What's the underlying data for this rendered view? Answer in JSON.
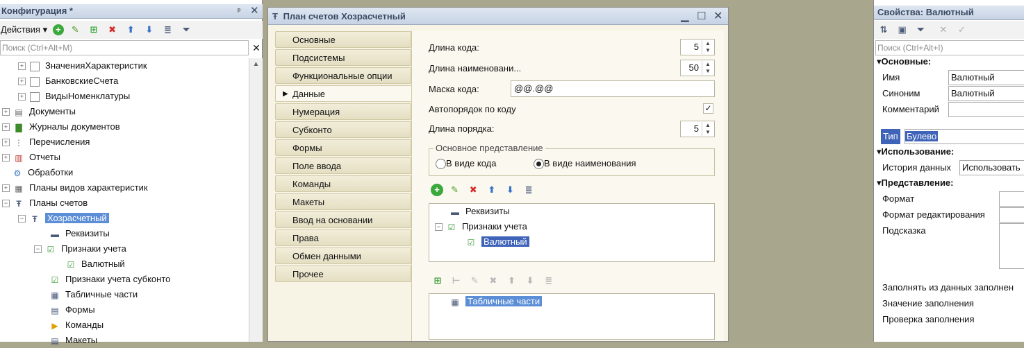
{
  "config_panel": {
    "title": "Конфигурация *",
    "pin": "ᵖ",
    "actions_label": "Действия",
    "search_placeholder": "Поиск (Ctrl+Alt+M)",
    "tree": [
      {
        "label": "ЗначенияХарактеристик"
      },
      {
        "label": "БанковскиеСчета"
      },
      {
        "label": "ВидыНоменклатуры"
      },
      {
        "label": "Документы"
      },
      {
        "label": "Журналы документов"
      },
      {
        "label": "Перечисления"
      },
      {
        "label": "Отчеты"
      },
      {
        "label": "Обработки"
      },
      {
        "label": "Планы видов характеристик"
      },
      {
        "label": "Планы счетов"
      },
      {
        "label": "Хозрасчетный"
      },
      {
        "label": "Реквизиты"
      },
      {
        "label": "Признаки учета"
      },
      {
        "label": "Валютный"
      },
      {
        "label": "Признаки учета субконто"
      },
      {
        "label": "Табличные части"
      },
      {
        "label": "Формы"
      },
      {
        "label": "Команды"
      },
      {
        "label": "Макеты"
      }
    ]
  },
  "window": {
    "title": "План счетов Хозрасчетный",
    "tabs": [
      {
        "label": "Основные"
      },
      {
        "label": "Подсистемы"
      },
      {
        "label": "Функциональные опции"
      },
      {
        "label": "Данные"
      },
      {
        "label": "Нумерация"
      },
      {
        "label": "Субконто"
      },
      {
        "label": "Формы"
      },
      {
        "label": "Поле ввода"
      },
      {
        "label": "Команды"
      },
      {
        "label": "Макеты"
      },
      {
        "label": "Ввод на основании"
      },
      {
        "label": "Права"
      },
      {
        "label": "Обмен данными"
      },
      {
        "label": "Прочее"
      }
    ],
    "active_tab": "Данные",
    "fields": {
      "code_length_label": "Длина кода:",
      "code_length_value": "5",
      "name_length_label": "Длина наименовани...",
      "name_length_value": "50",
      "code_mask_label": "Маска кода:",
      "code_mask_value": "@@.@@",
      "autoorder_label": "Автопорядок по коду",
      "autoorder_checked": true,
      "order_length_label": "Длина порядка:",
      "order_length_value": "5"
    },
    "main_repr": {
      "group_label": "Основное представление",
      "option_code": "В виде кода",
      "option_name": "В виде наименования",
      "selected": "В виде наименования"
    },
    "attrs_tree": [
      {
        "label": "Реквизиты"
      },
      {
        "label": "Признаки учета"
      },
      {
        "label": "Валютный"
      }
    ],
    "tabular_tree": [
      {
        "label": "Табличные части"
      }
    ]
  },
  "properties": {
    "title": "Свойства: Валютный",
    "search_placeholder": "Поиск (Ctrl+Alt+I)",
    "section_main": "Основные:",
    "name_label": "Имя",
    "name_value": "Валютный",
    "synonym_label": "Синоним",
    "synonym_value": "Валютный",
    "comment_label": "Комментарий",
    "comment_value": "",
    "type_label": "Тип",
    "type_value": "Булево",
    "section_usage": "Использование:",
    "history_label": "История данных",
    "history_value": "Использовать",
    "section_repr": "Представление:",
    "format_label": "Формат",
    "edit_format_label": "Формат редактирования",
    "hint_label": "Подсказка",
    "fill_from_label": "Заполнять из данных заполнен",
    "fill_value_label": "Значение заполнения",
    "fill_check_label": "Проверка заполнения"
  },
  "colors": {
    "selection": "#5b8ed6",
    "selection_dark": "#3e63b8",
    "window_bg": "#f7f4e6",
    "desktop": "#a9a68e"
  }
}
